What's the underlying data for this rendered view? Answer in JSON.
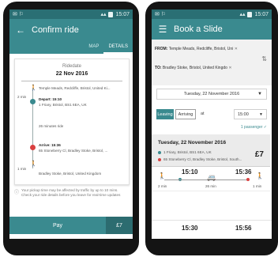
{
  "left_screen": {
    "status_time": "15:07",
    "title": "Confirm ride",
    "tabs": [
      "MAP",
      "DETAILS"
    ],
    "ride_date_label": "Ridedate",
    "ride_date": "22 Nov 2016",
    "walk1_time": "2 min",
    "start_address": "Temple Meads, Redcliffe, Bristol, United Ki...",
    "depart_label": "Depart: 15:10",
    "depart_address": "1 Friary, Bristol, BS1 6EA, UK",
    "ride_duration": "26 minutes ride",
    "arrive_label": "Arrive: 15:36",
    "arrive_address": "65 Stoneberry Cl, Bradley Stoke, Bristol, ...",
    "walk2_time": "1 min",
    "end_address": "Bradley Stoke, Bristol, United Kingdom",
    "notice": "Your pickup time may be affected by traffic by up to 10 mins. Check your ride details before you leave for real-time updates",
    "pay_label": "Pay",
    "price": "£7"
  },
  "right_screen": {
    "status_time": "15:07",
    "title": "Book a Slide",
    "from_label": "FROM:",
    "from_value": "Temple Meads, Redcliffe, Bristol, Uni",
    "to_label": "TO:",
    "to_value": "Bradley Stoke, Bristol, United Kingdo",
    "date_value": "Tuesday, 22 November 2016",
    "leaving_label": "Leaving",
    "arriving_label": "Arriving",
    "at_label": "at",
    "time_value": "15:00",
    "passenger_label": "1 passenger",
    "result_date": "Tuesday, 22 November 2016",
    "result_pickup": "1 Friary, Bristol, BS1 6EA, UK",
    "result_dropoff": "65 Stoneberry Cl, Bradley Stoke, Bristol, South...",
    "result_price": "£7",
    "option1_depart": "15:10",
    "option1_arrive": "15:36",
    "walk_a": "2 min",
    "ride_len": "26 min",
    "walk_b": "1 min",
    "option2_depart": "15:30",
    "option2_arrive": "15:56"
  }
}
